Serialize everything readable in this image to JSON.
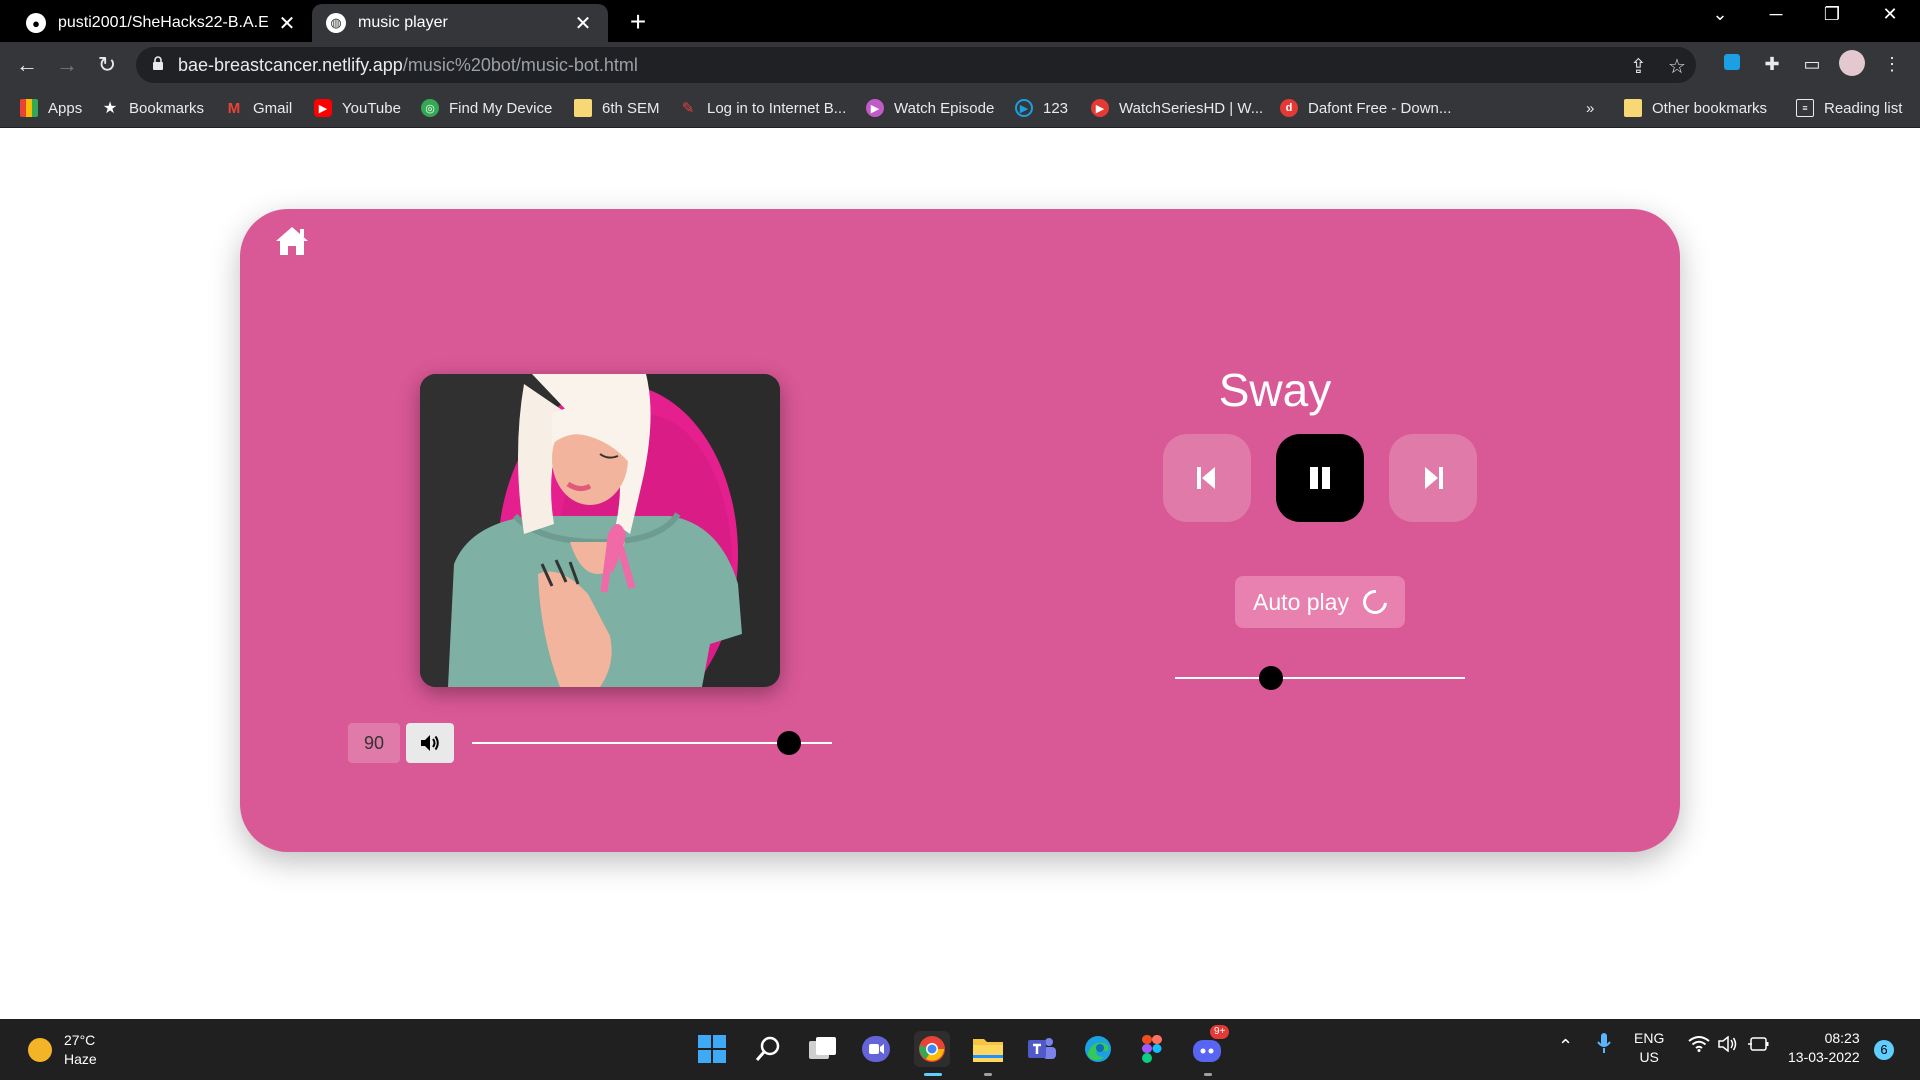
{
  "browser": {
    "tabs": [
      {
        "title": "pusti2001/SheHacks22-B.A.E",
        "favicon": "github-icon",
        "active": false
      },
      {
        "title": "music player",
        "favicon": "globe-icon",
        "active": true
      }
    ],
    "url_domain": "bae-breastcancer.netlify.app",
    "url_path": "/music%20bot/music-bot.html",
    "bookmarks": [
      {
        "label": "Apps",
        "icon": "apps-grid-icon"
      },
      {
        "label": "Bookmarks",
        "icon": "star-icon"
      },
      {
        "label": "Gmail",
        "icon": "gmail-icon"
      },
      {
        "label": "YouTube",
        "icon": "youtube-icon"
      },
      {
        "label": "Find My Device",
        "icon": "find-device-icon"
      },
      {
        "label": "6th SEM",
        "icon": "folder-icon"
      },
      {
        "label": "Log in to Internet B...",
        "icon": "internet-icon"
      },
      {
        "label": "Watch Episode",
        "icon": "play-icon"
      },
      {
        "label": "123",
        "icon": "play-circle-icon"
      },
      {
        "label": "WatchSeriesHD | W...",
        "icon": "play-icon"
      },
      {
        "label": "Dafont Free - Down...",
        "icon": "dafont-icon"
      }
    ],
    "overflow_label": "»",
    "other_bookmarks": "Other bookmarks",
    "reading_list": "Reading list"
  },
  "player": {
    "song_title": "Sway",
    "volume_value": "90",
    "volume_level": 0.88,
    "seek_position": 0.33,
    "autoplay_label": "Auto play",
    "colors": {
      "card": "#d95896",
      "button": "#e07aa8",
      "play_button": "#000000"
    }
  },
  "taskbar": {
    "temperature": "27°C",
    "weather": "Haze",
    "language": "ENG",
    "region": "US",
    "time": "08:23",
    "date": "13-03-2022",
    "notifications": "6",
    "discord_badge": "9+"
  }
}
